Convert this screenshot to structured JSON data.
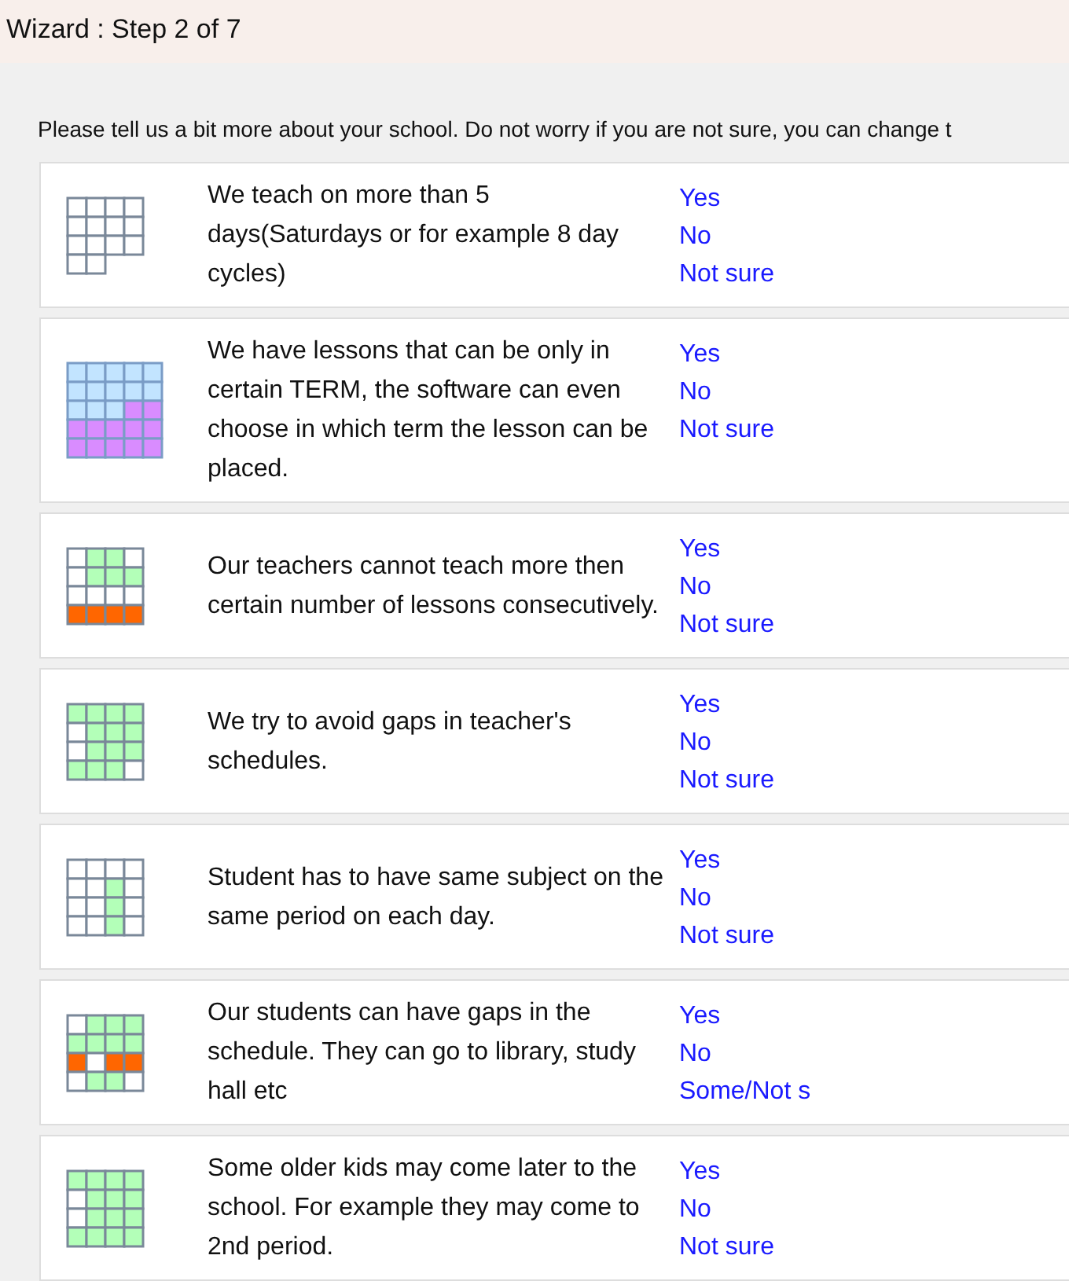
{
  "window": {
    "title": "Wizard : Step 2 of 7"
  },
  "intro": "Please tell us a bit more about your school. Do not worry if you are not sure, you can change t",
  "questions": [
    {
      "text": "We teach on more than 5 days(Saturdays or for example 8 day cycles)",
      "options": [
        "Yes",
        "No",
        "Not sure"
      ]
    },
    {
      "text": "We have lessons that can be only in certain TERM, the software can even choose in which term the lesson can be placed.",
      "options": [
        "Yes",
        "No",
        "Not sure"
      ]
    },
    {
      "text": "Our teachers cannot teach more then certain number of lessons consecutively.",
      "options": [
        "Yes",
        "No",
        "Not sure"
      ]
    },
    {
      "text": "We try to avoid gaps in teacher's schedules.",
      "options": [
        "Yes",
        "No",
        "Not sure"
      ]
    },
    {
      "text": "Student has to have same subject on the same period on each day.",
      "options": [
        "Yes",
        "No",
        "Not sure"
      ]
    },
    {
      "text": "Our students can have gaps in the schedule. They can go to library, study hall etc",
      "options": [
        "Yes",
        "No",
        "Some/Not s"
      ]
    },
    {
      "text": "Some older kids may come later to the school. For example they may come to 2nd period.",
      "options": [
        "Yes",
        "No",
        "Not sure"
      ]
    }
  ]
}
